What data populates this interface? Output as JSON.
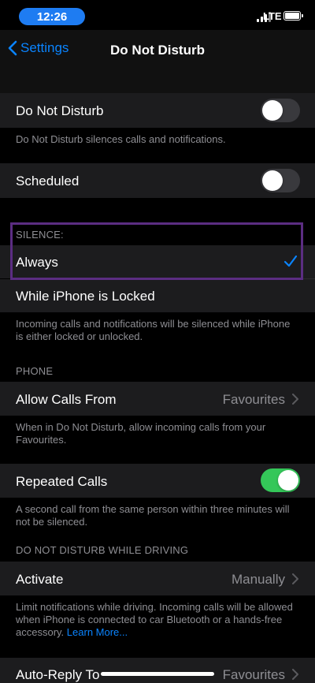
{
  "status": {
    "time": "12:26",
    "network": "LTE"
  },
  "nav": {
    "back_label": "Settings",
    "title": "Do Not Disturb"
  },
  "dnd": {
    "label": "Do Not Disturb",
    "enabled": false,
    "footer": "Do Not Disturb silences calls and notifications."
  },
  "scheduled": {
    "label": "Scheduled",
    "enabled": false
  },
  "silence": {
    "header": "SILENCE:",
    "options": [
      {
        "label": "Always",
        "selected": true
      },
      {
        "label": "While iPhone is Locked",
        "selected": false
      }
    ],
    "footer_line1": "Incoming calls and notifications will be silenced while iPhone",
    "footer_line2": "is either locked or unlocked."
  },
  "phone": {
    "header": "PHONE",
    "allow_calls": {
      "label": "Allow Calls From",
      "value": "Favourites"
    },
    "allow_footer_line1": "When in Do Not Disturb, allow incoming calls from your",
    "allow_footer_line2": "Favourites.",
    "repeated": {
      "label": "Repeated Calls",
      "enabled": true
    },
    "repeated_footer_line1": "A second call from the same person within three minutes will",
    "repeated_footer_line2": "not be silenced."
  },
  "driving": {
    "header": "DO NOT DISTURB WHILE DRIVING",
    "activate": {
      "label": "Activate",
      "value": "Manually"
    },
    "footer_line1": "Limit notifications while driving. Incoming calls will be allowed",
    "footer_line2": "when iPhone is connected to car Bluetooth or a hands-free",
    "footer_line3_text": "accessory.",
    "footer_link": "Learn More...",
    "auto_reply": {
      "label": "Auto-Reply To",
      "value": "Favourites"
    }
  },
  "colors": {
    "accent": "#0a84ff",
    "toggle_on": "#34c759",
    "highlight_border": "#5b2d82"
  }
}
